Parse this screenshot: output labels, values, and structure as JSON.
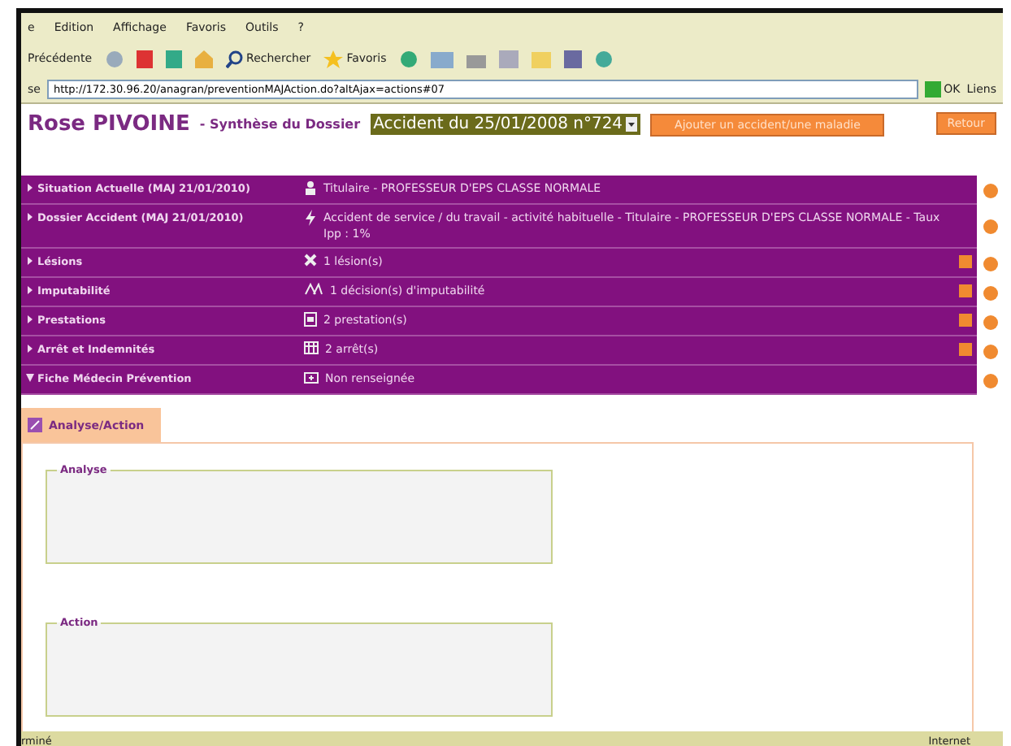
{
  "menu_bar": [
    "e",
    "Edition",
    "Affichage",
    "Favoris",
    "Outils",
    "?"
  ],
  "toolbar": {
    "back": "Précédente",
    "search": "Rechercher",
    "favorites": "Favoris"
  },
  "address_bar": {
    "label": "se",
    "url": "http://172.30.96.20/anagran/preventionMAJAction.do?altAjax=actions#07",
    "go": "OK",
    "links": "Liens"
  },
  "header": {
    "name": "Rose PIVOINE",
    "subtitle": "- Synthèse du Dossier",
    "dossier_select": "Accident du 25/01/2008 n°724",
    "add_button": "Ajouter un accident/une maladie",
    "back_button": "Retour"
  },
  "sections": [
    {
      "label": "Situation Actuelle (MAJ 21/01/2010)",
      "kind": "person",
      "value": "Titulaire - PROFESSEUR D'EPS CLASSE NORMALE",
      "expanded": false,
      "addable": false
    },
    {
      "label": "Dossier Accident (MAJ 21/01/2010)",
      "kind": "bolt",
      "value": "Accident de service / du travail - activité habituelle - Titulaire - PROFESSEUR D'EPS CLASSE NORMALE - Taux Ipp : 1%",
      "expanded": false,
      "addable": false
    },
    {
      "label": "Lésions",
      "kind": "cross",
      "value": "1 lésion(s)",
      "expanded": false,
      "addable": true
    },
    {
      "label": "Imputabilité",
      "kind": "scale",
      "value": "1 décision(s) d'imputabilité",
      "expanded": false,
      "addable": true
    },
    {
      "label": "Prestations",
      "kind": "doc",
      "value": "2 prestation(s)",
      "expanded": false,
      "addable": true
    },
    {
      "label": "Arrêt et Indemnités",
      "kind": "calendar",
      "value": "2 arrêt(s)",
      "expanded": false,
      "addable": true
    },
    {
      "label": "Fiche Médecin Prévention",
      "kind": "kit",
      "value": "Non renseignée",
      "expanded": true,
      "addable": false
    }
  ],
  "tabs": [
    {
      "label": "Analyse/Action",
      "selected": true
    }
  ],
  "fieldsets": [
    {
      "legend": "Analyse"
    },
    {
      "legend": "Action"
    }
  ],
  "status_bar": {
    "text": "rminé",
    "zone": "Internet"
  }
}
